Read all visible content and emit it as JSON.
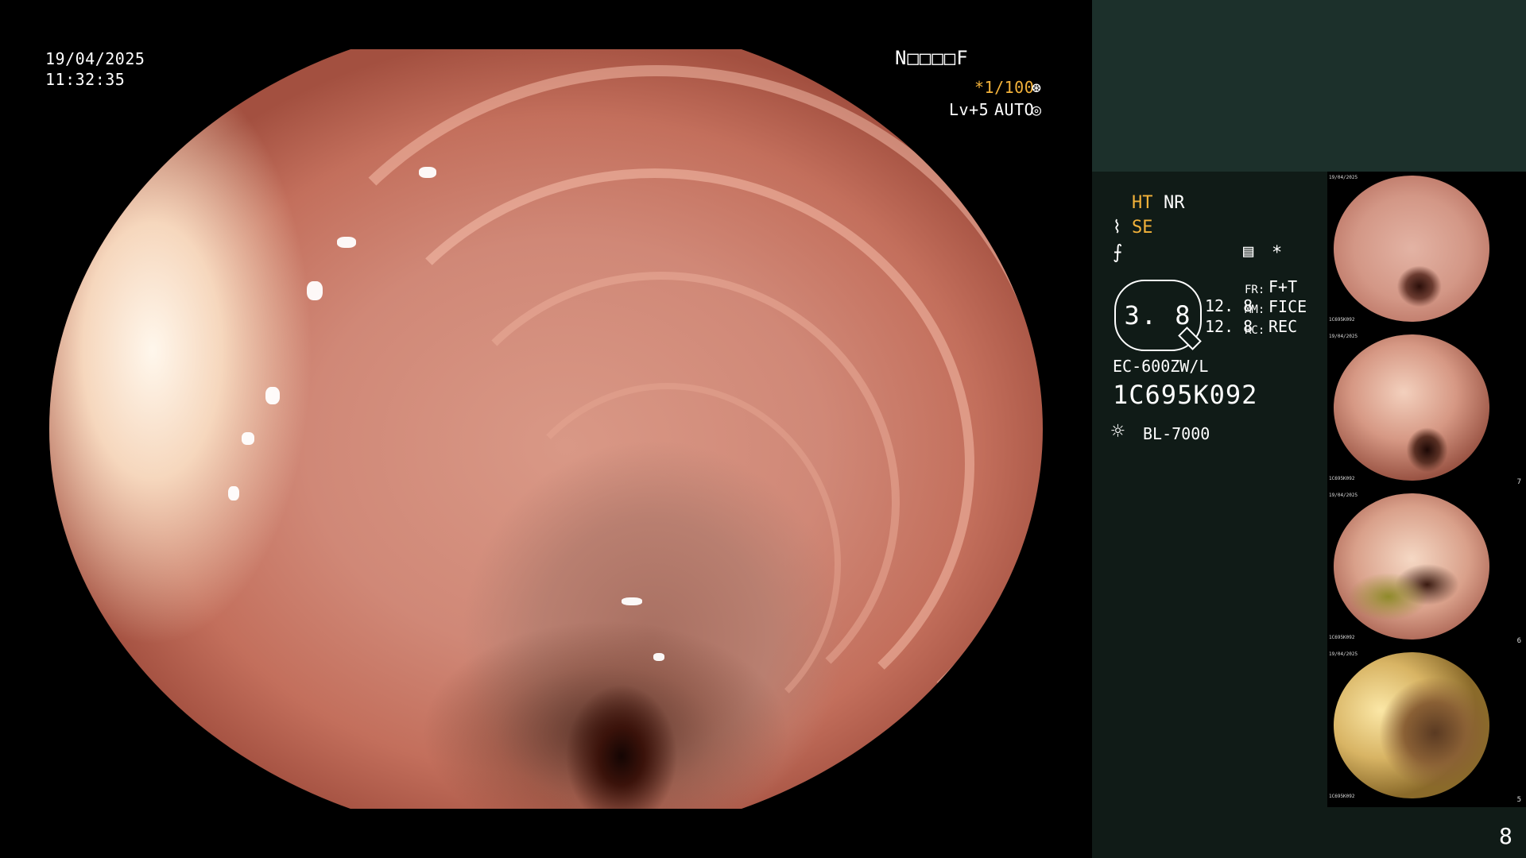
{
  "overlay": {
    "date": "19/04/2025",
    "time": "11:32:35",
    "patient_id": "N□□□□F",
    "shutter": "*1/100",
    "shutter_icon": "⊛",
    "level": "Lv+5",
    "mode": "AUTO",
    "mode_icon": "◎"
  },
  "panel": {
    "ht": "HT",
    "nr": "NR",
    "se_icon": "⌇",
    "se": "SE",
    "f_icon": "⨍",
    "menu_icon": "▤",
    "star": "*",
    "zoom": "3. 8",
    "values": [
      "12. 8",
      "12. 8"
    ],
    "keys": [
      "FR:",
      "MM:",
      "RC:"
    ],
    "settings": [
      "F+T",
      "FICE",
      "REC"
    ],
    "scope_model": "EC-600ZW/L",
    "serial": "1C695K092",
    "lamp_icon": "☼",
    "lamp": "BL-7000",
    "page": "8"
  },
  "thumbnails": [
    {
      "num": "",
      "date": "19/04/2025",
      "serial": "1C695K092"
    },
    {
      "num": "7",
      "date": "19/04/2025",
      "serial": "1C695K092"
    },
    {
      "num": "6",
      "date": "19/04/2025",
      "serial": "1C695K092"
    },
    {
      "num": "5",
      "date": "19/04/2025",
      "serial": "1C695K092"
    }
  ],
  "colors": {
    "accent": "#f3b23a",
    "panel_bg": "#101b17",
    "panel_top": "#1c302b"
  },
  "icons": [
    "shutter-icon",
    "auto-mode-icon",
    "se-icon",
    "filter-icon",
    "menu-icon",
    "zoom-icon",
    "lamp-icon"
  ]
}
